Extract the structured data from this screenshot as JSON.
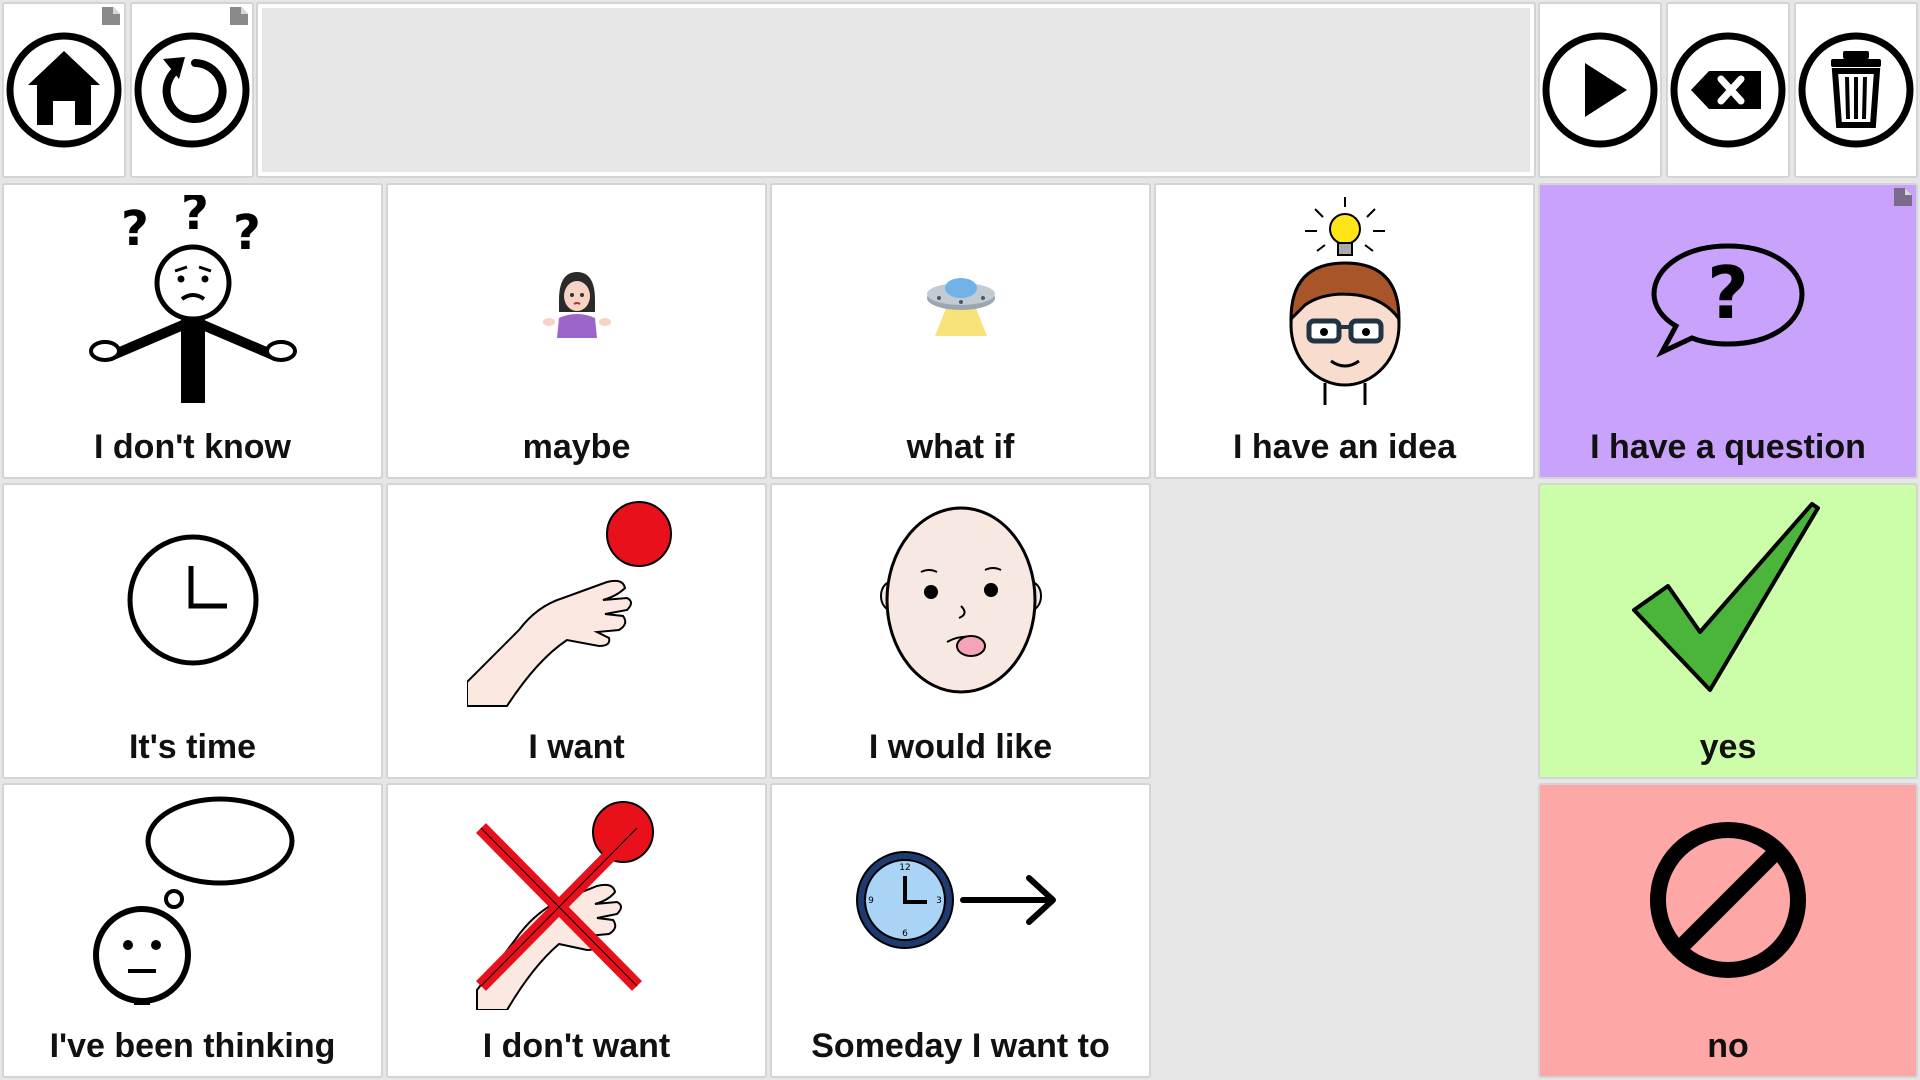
{
  "toolbar": {
    "home_icon": "home-icon",
    "back_icon": "undo-icon",
    "speak_icon": "play-icon",
    "backspace_icon": "backspace-icon",
    "clear_icon": "trash-icon",
    "message": ""
  },
  "tiles": [
    {
      "label": "I don't know",
      "bg": "#ffffff"
    },
    {
      "label": "maybe",
      "bg": "#ffffff"
    },
    {
      "label": "what if",
      "bg": "#ffffff"
    },
    {
      "label": "I have an idea",
      "bg": "#ffffff"
    },
    {
      "label": "I have a question",
      "bg": "#c9a3fb"
    },
    {
      "label": "It's time",
      "bg": "#ffffff"
    },
    {
      "label": "I want",
      "bg": "#ffffff"
    },
    {
      "label": "I would like",
      "bg": "#ffffff"
    },
    {
      "label": "yes",
      "bg": "#ccfda9"
    },
    {
      "label": "I've been thinking",
      "bg": "#ffffff"
    },
    {
      "label": "I don't want",
      "bg": "#ffffff"
    },
    {
      "label": "Someday I want to",
      "bg": "#ffffff"
    },
    {
      "label": "no",
      "bg": "#fea7a7"
    }
  ],
  "colors": {
    "purple": "#c9a3fb",
    "green": "#ccfda9",
    "red": "#fea7a7",
    "grid_bg": "#e6e6e6"
  }
}
